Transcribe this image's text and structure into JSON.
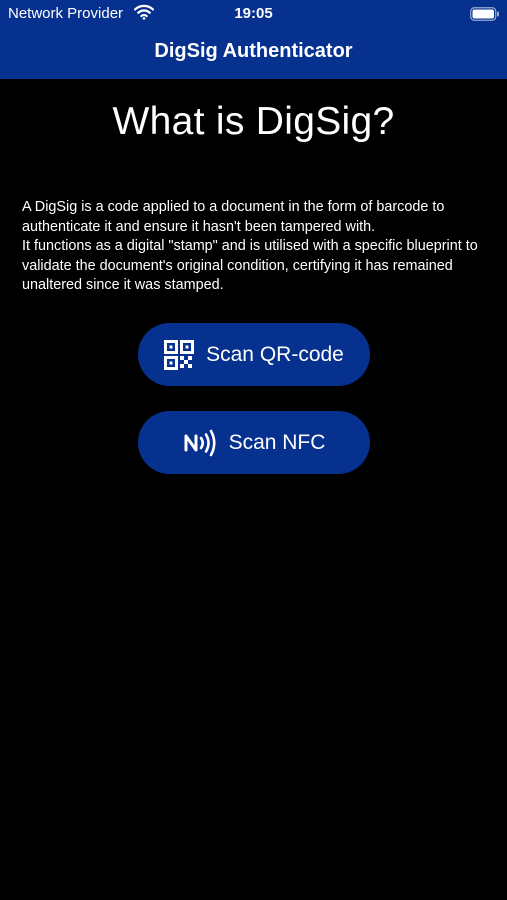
{
  "status_bar": {
    "carrier": "Network Provider",
    "time": "19:05",
    "wifi_icon": "wifi-icon",
    "battery_icon": "battery-icon"
  },
  "nav": {
    "title": "DigSig Authenticator"
  },
  "main": {
    "heading": "What is DigSig?",
    "description": "A DigSig is a code applied to a document in the form of barcode to authenticate it and ensure it hasn't been tampered with.\nIt functions as a digital \"stamp\" and is utilised with a specific blueprint to validate the document's original condition, certifying it has remained unaltered since it was stamped.",
    "buttons": [
      {
        "label": "Scan QR-code",
        "icon": "qr-code-icon"
      },
      {
        "label": "Scan NFC",
        "icon": "nfc-icon"
      }
    ]
  },
  "colors": {
    "primary": "#06318f",
    "background": "#000000",
    "text": "#ffffff"
  }
}
